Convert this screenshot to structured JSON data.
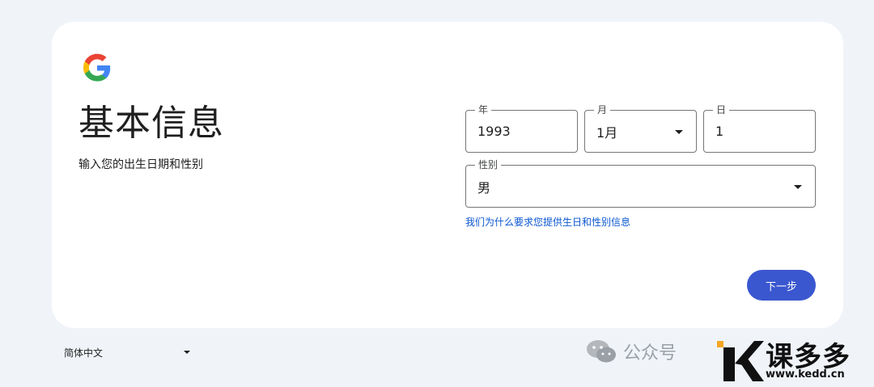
{
  "header": {
    "logo_icon": "google-g-icon",
    "title": "基本信息",
    "subtitle": "输入您的出生日期和性别"
  },
  "form": {
    "year": {
      "label": "年",
      "value": "1993"
    },
    "month": {
      "label": "月",
      "value": "1月"
    },
    "day": {
      "label": "日",
      "value": "1"
    },
    "gender": {
      "label": "性别",
      "value": "男"
    },
    "why_link": "我们为什么要求您提供生日和性别信息",
    "next_label": "下一步"
  },
  "footer": {
    "language": "简体中文"
  },
  "watermark": {
    "wechat_text": "公众号",
    "brand_name": "课多多",
    "brand_url": "www.kedd.cn"
  },
  "colors": {
    "background": "#f0f4f9",
    "card": "#ffffff",
    "accent": "#3a57d0",
    "link": "#0b57d0",
    "border": "#747775"
  }
}
